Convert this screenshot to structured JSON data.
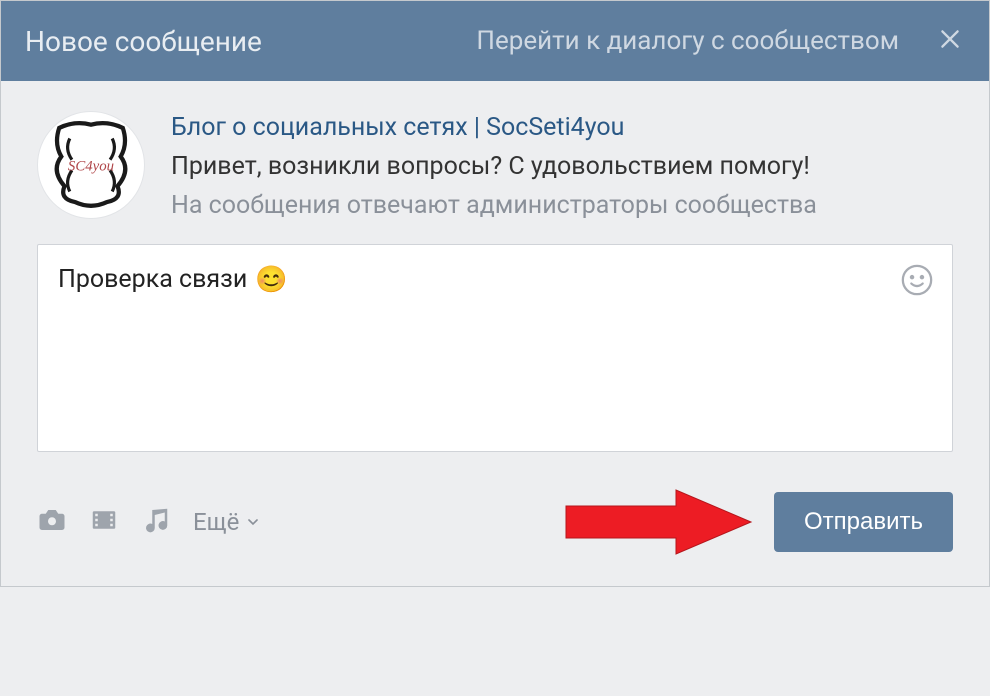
{
  "header": {
    "title": "Новое сообщение",
    "dialog_link": "Перейти к диалогу с сообществом"
  },
  "community": {
    "name": "Блог о социальных сетях | SocSeti4you",
    "greeting": "Привет, возникли вопросы? С удовольствием помогу!",
    "admin_note": "На сообщения отвечают администраторы сообщества"
  },
  "message": {
    "text": "Проверка связи",
    "emoji": "😊"
  },
  "footer": {
    "more_label": "Ещё",
    "send_label": "Отправить"
  }
}
